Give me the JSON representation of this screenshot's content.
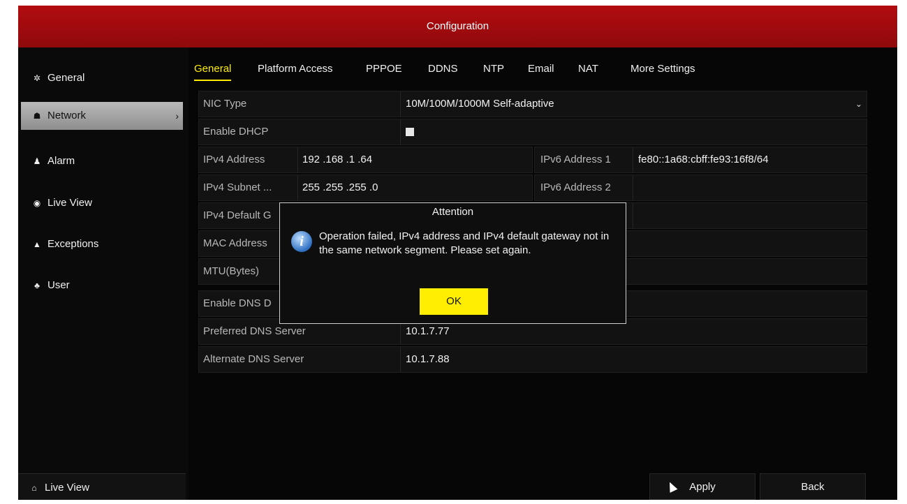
{
  "window": {
    "title": "Configuration"
  },
  "sidebar": {
    "items": [
      {
        "label": "General",
        "icon": "gear-icon"
      },
      {
        "label": "Network",
        "icon": "network-icon",
        "chevron": "›"
      },
      {
        "label": "Alarm",
        "icon": "alarm-icon"
      },
      {
        "label": "Live View",
        "icon": "eye-icon"
      },
      {
        "label": "Exceptions",
        "icon": "warning-icon"
      },
      {
        "label": "User",
        "icon": "users-icon"
      }
    ],
    "bottom": {
      "label": "Live View",
      "icon": "home-icon"
    }
  },
  "tabs": [
    "General",
    "Platform Access",
    "PPPOE",
    "DDNS",
    "NTP",
    "Email",
    "NAT",
    "More Settings"
  ],
  "form": {
    "nic_type_label": "NIC Type",
    "nic_type_value": "10M/100M/1000M Self-adaptive",
    "enable_dhcp_label": "Enable DHCP",
    "ipv4_address_label": "IPv4 Address",
    "ipv4_address_value": "192 .168 .1    .64",
    "ipv6_address1_label": "IPv6 Address 1",
    "ipv6_address1_value": "fe80::1a68:cbff:fe93:16f8/64",
    "ipv4_subnet_label": "IPv4 Subnet ...",
    "ipv4_subnet_value": "255 .255 .255 .0",
    "ipv6_address2_label": "IPv6 Address 2",
    "ipv4_default_label": "IPv4 Default G",
    "mac_address_label": "MAC Address",
    "mtu_label": "MTU(Bytes)",
    "enable_dns_label": "Enable DNS D",
    "preferred_dns_label": "Preferred DNS Server",
    "preferred_dns_value": "10.1.7.77",
    "alternate_dns_label": "Alternate DNS Server",
    "alternate_dns_value": "10.1.7.88"
  },
  "buttons": {
    "apply": "Apply",
    "back": "Back"
  },
  "dialog": {
    "title": "Attention",
    "icon_glyph": "i",
    "message": "Operation failed, IPv4 address and IPv4 default gateway not in the same network segment. Please set again.",
    "ok": "OK"
  },
  "colors": {
    "accent": "#ffee00",
    "titlebar": "#a00c0e",
    "active_item": "#a8a8a8"
  }
}
